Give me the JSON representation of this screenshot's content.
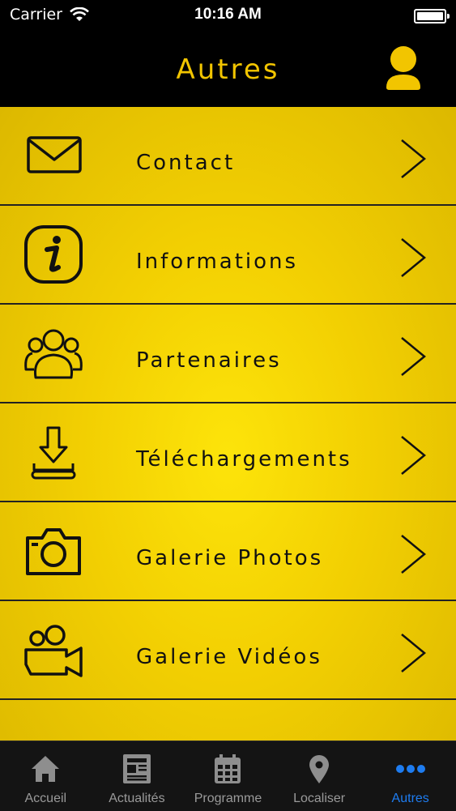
{
  "status_bar": {
    "carrier": "Carrier",
    "time": "10:16 AM"
  },
  "header": {
    "title": "Autres"
  },
  "colors": {
    "accent": "#f2c500",
    "tab_active": "#1e7cf0",
    "tab_inactive": "#9a9a9a"
  },
  "menu": {
    "items": [
      {
        "label": "Contact",
        "icon": "envelope-icon"
      },
      {
        "label": "Informations",
        "icon": "info-icon"
      },
      {
        "label": "Partenaires",
        "icon": "people-icon"
      },
      {
        "label": "Téléchargements",
        "icon": "download-icon"
      },
      {
        "label": "Galerie Photos",
        "icon": "camera-icon"
      },
      {
        "label": "Galerie Vidéos",
        "icon": "video-camera-icon"
      }
    ]
  },
  "tab_bar": {
    "tabs": [
      {
        "label": "Accueil",
        "icon": "home-icon"
      },
      {
        "label": "Actualités",
        "icon": "newspaper-icon"
      },
      {
        "label": "Programme",
        "icon": "calendar-icon"
      },
      {
        "label": "Localiser",
        "icon": "map-pin-icon"
      },
      {
        "label": "Autres",
        "icon": "more-dots-icon",
        "active": true
      }
    ]
  }
}
